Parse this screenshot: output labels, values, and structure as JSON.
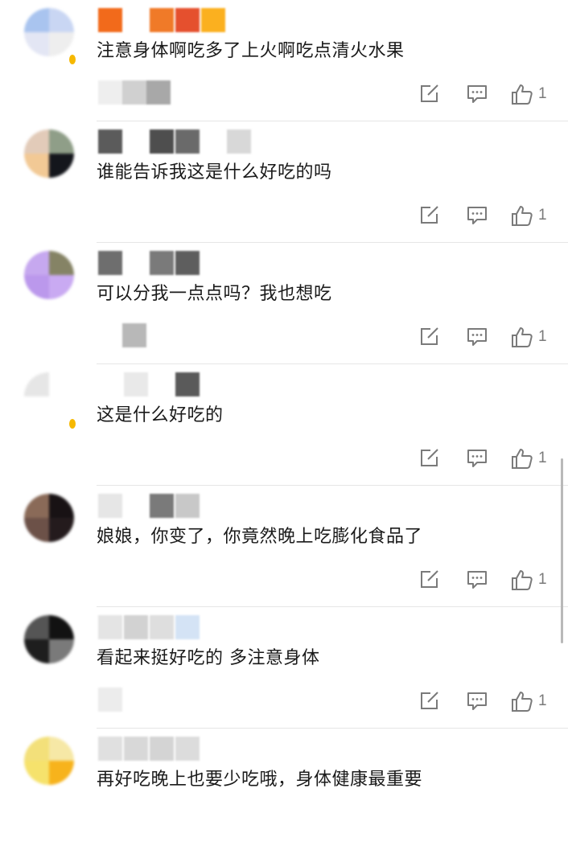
{
  "comments": [
    {
      "text": "注意身体啊吃多了上火啊吃点清火水果",
      "like_count": "1",
      "avatar_colors": [
        "#a9c4ef",
        "#c9d6f3",
        "#e3e6f4",
        "#eeeeee"
      ],
      "name_colors": [
        "#f26a1b",
        "#ffffff",
        "#f07a28",
        "#e5502e",
        "#fbb01f"
      ],
      "meta_colors": [
        "#eeeeee",
        "#d0d0d0",
        "#a8a8a8"
      ],
      "badge": true
    },
    {
      "text": "谁能告诉我这是什么好吃的吗",
      "like_count": "1",
      "avatar_colors": [
        "#e2cbb9",
        "#8f9e88",
        "#f2c995",
        "#14161c"
      ],
      "name_colors": [
        "#5b5b5b",
        "#ffffff",
        "#4e4e4e",
        "#6a6a6a",
        "#ffffff",
        "#d8d8d8"
      ],
      "meta_colors": [],
      "badge": false
    },
    {
      "text": "可以分我一点点吗？我也想吃",
      "like_count": "1",
      "avatar_colors": [
        "#c6a8ef",
        "#858365",
        "#bb98ec",
        "#c9aaf2"
      ],
      "name_colors": [
        "#6e6e6e",
        "#ffffff",
        "#7a7a7a",
        "#5e5e5e"
      ],
      "meta_colors": [
        "#ffffff",
        "#b8b8b8"
      ],
      "badge": false
    },
    {
      "text": "这是什么好吃的",
      "like_count": "1",
      "avatar_colors": [
        "#e6e6e6",
        "#ffffff",
        "#ffffff",
        "#ffffff"
      ],
      "name_colors": [
        "#ffffff",
        "#e9e9e9",
        "#ffffff",
        "#5a5a5a"
      ],
      "meta_colors": [],
      "badge": true
    },
    {
      "text": "娘娘，你变了，你竟然晚上吃膨化食品了",
      "like_count": "1",
      "avatar_colors": [
        "#8a6a58",
        "#181214",
        "#6c5148",
        "#241b1d"
      ],
      "name_colors": [
        "#e6e6e6",
        "#ffffff",
        "#7a7a7a",
        "#c8c8c8"
      ],
      "meta_colors": [],
      "badge": false
    },
    {
      "text": "看起来挺好吃的  多注意身体",
      "like_count": "1",
      "avatar_colors": [
        "#555555",
        "#121212",
        "#1e1e1e",
        "#7a7a7a"
      ],
      "name_colors": [
        "#e4e4e4",
        "#d2d2d2",
        "#dedede",
        "#d4e3f5"
      ],
      "meta_colors": [
        "#ececec"
      ],
      "badge": false
    },
    {
      "text": "再好吃晚上也要少吃哦，身体健康最重要",
      "like_count": "",
      "avatar_colors": [
        "#f3e07a",
        "#f6e8a6",
        "#f6e26c",
        "#f7b31c"
      ],
      "name_colors": [
        "#e0e0e0",
        "#d8d8d8",
        "#d4d4d4",
        "#dcdcdc"
      ],
      "meta_colors": [],
      "badge": false
    }
  ],
  "icons": {
    "share": "share-edit-icon",
    "reply": "comment-reply-icon",
    "like": "thumbs-up-icon"
  },
  "colors": {
    "icon_gray": "#7a7a7a",
    "divider": "#e6e6e6"
  }
}
